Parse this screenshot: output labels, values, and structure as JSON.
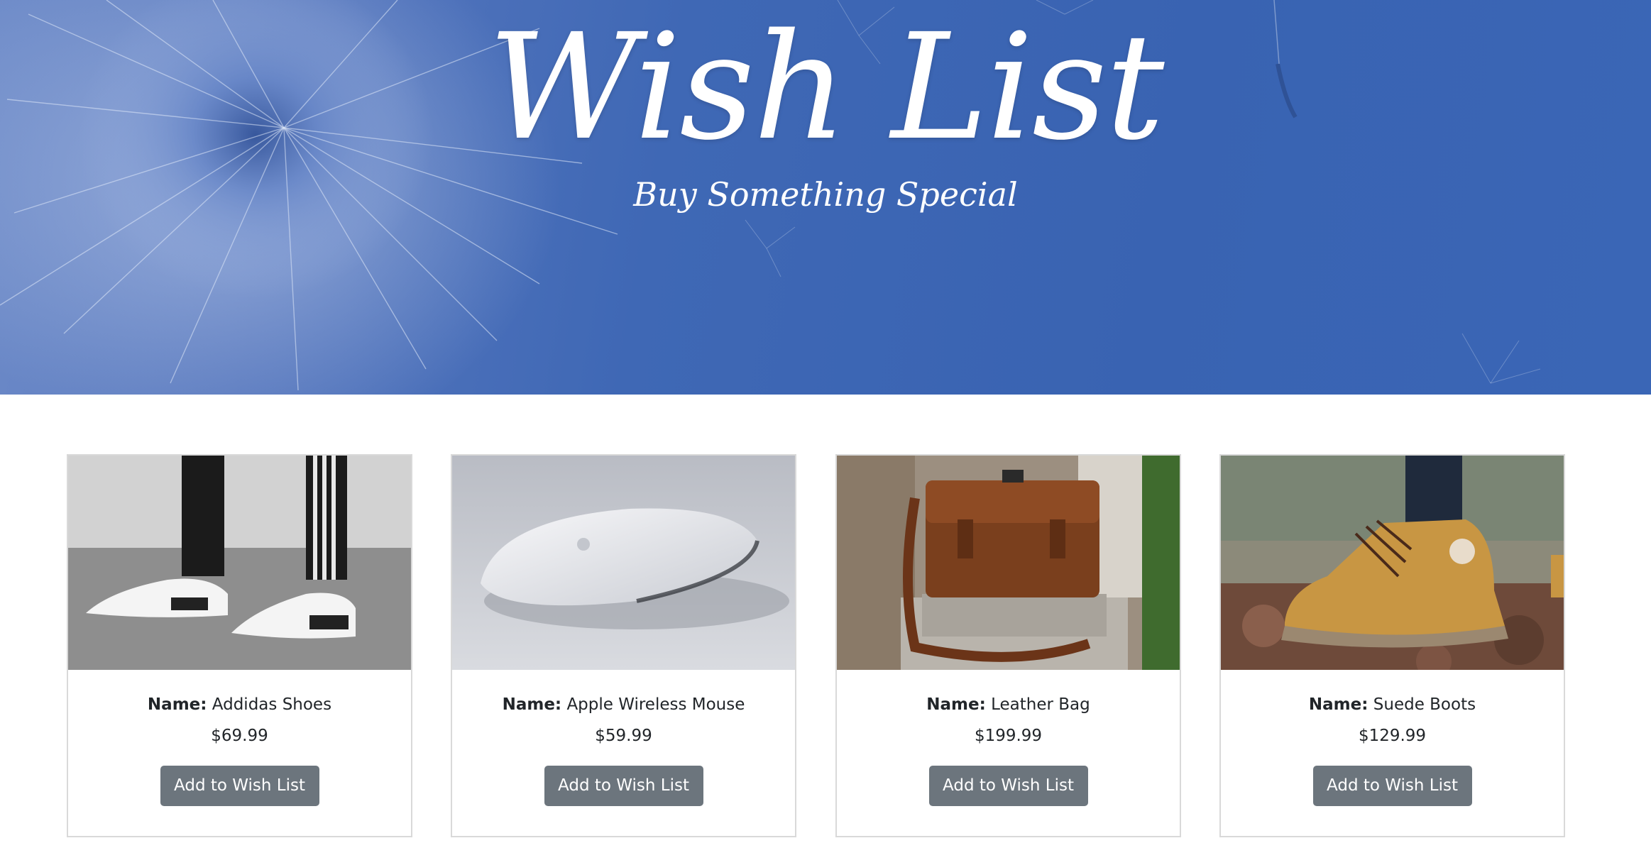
{
  "hero": {
    "title": "Wish List",
    "subtitle": "Buy Something Special"
  },
  "products": [
    {
      "name_label": "Name:",
      "name": "Addidas Shoes",
      "price": "$69.99",
      "button_label": "Add to Wish List",
      "image": "white-sneakers-photo"
    },
    {
      "name_label": "Name:",
      "name": "Apple Wireless Mouse",
      "price": "$59.99",
      "button_label": "Add to Wish List",
      "image": "white-mouse-photo"
    },
    {
      "name_label": "Name:",
      "name": "Leather Bag",
      "price": "$199.99",
      "button_label": "Add to Wish List",
      "image": "leather-bag-photo"
    },
    {
      "name_label": "Name:",
      "name": "Suede Boots",
      "price": "$129.99",
      "button_label": "Add to Wish List",
      "image": "suede-boots-photo"
    }
  ],
  "colors": {
    "hero_blue": "#3a64b3",
    "button_gray": "#6c757d",
    "card_border": "#d9d9d9"
  }
}
